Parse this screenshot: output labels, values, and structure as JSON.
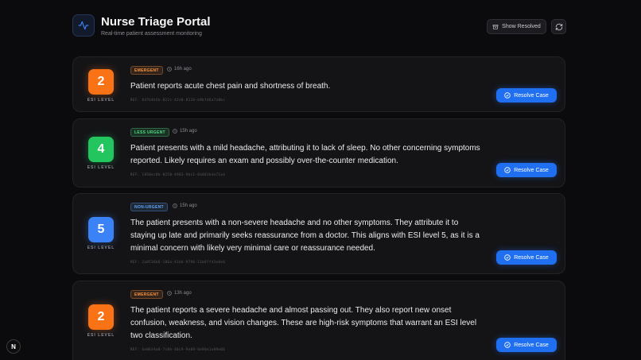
{
  "header": {
    "title": "Nurse Triage Portal",
    "subtitle": "Real-time patient assessment monitoring",
    "show_resolved_label": "Show Resolved"
  },
  "esi_label": "ESI LEVEL",
  "resolve_label": "Resolve Case",
  "cases": [
    {
      "esi": "2",
      "esi_color": "#f97316",
      "badge": "EMERGENT",
      "badge_color": "#fb923c",
      "time": "16h ago",
      "description": "Patient reports acute chest pain and shortness of breath.",
      "ref": "REF: 847b4b5b-822c-42e0-8236-b9bf46a7a8bc"
    },
    {
      "esi": "4",
      "esi_color": "#22c55e",
      "badge": "LESS URGENT",
      "badge_color": "#4ade80",
      "time": "15h ago",
      "description": "Patient presents with a mild headache, attributing it to lack of sleep. No other concerning symptoms reported. Likely requires an exam and possibly over-the-counter medication.",
      "ref": "REF: 1850ec0b-8250-4903-9bc1-0a001b4e71a4"
    },
    {
      "esi": "5",
      "esi_color": "#3b82f6",
      "badge": "NON-URGENT",
      "badge_color": "#60a5fa",
      "time": "15h ago",
      "description": "The patient presents with a non-severe headache and no other symptoms. They attribute it to staying up late and primarily seeks reassurance from a doctor. This aligns with ESI level 5, as it is a minimal concern with likely very minimal care or reassurance needed.",
      "ref": "REF: 2a0536b6-106a-41bb-9796-11b07f43e6e6"
    },
    {
      "esi": "2",
      "esi_color": "#f97316",
      "badge": "EMERGENT",
      "badge_color": "#fb923c",
      "time": "13h ago",
      "description": "The patient reports a severe headache and almost passing out. They also report new onset confusion, weakness, and vision changes. These are high-risk symptoms that warrant an ESI level two classification.",
      "ref": "REF: 6e0634a0-7c8b-40c9-9e09-0e90e1a89e06"
    }
  ],
  "dev_badge": "N"
}
